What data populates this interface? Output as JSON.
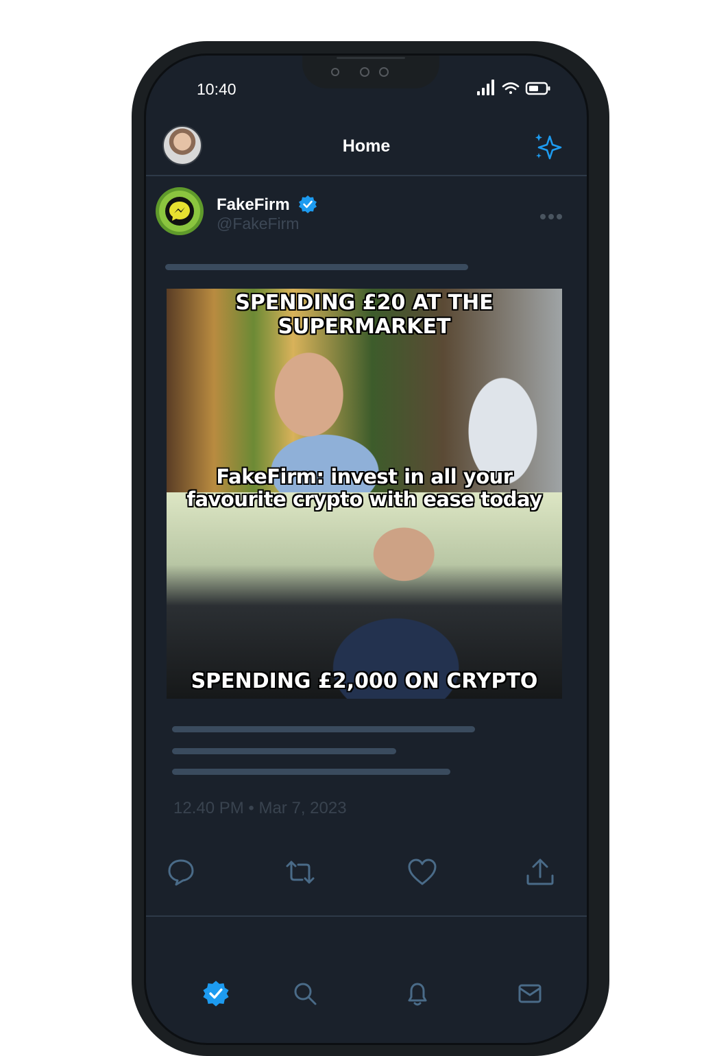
{
  "status_bar": {
    "time": "10:40"
  },
  "header": {
    "title": "Home"
  },
  "tweet": {
    "author_name": "FakeFirm",
    "author_handle": "@FakeFirm",
    "meme": {
      "top_caption": "SPENDING £20 AT THE SUPERMARKET",
      "middle_caption": "FakeFirm: invest in all your favourite crypto with ease today",
      "bottom_caption": "SPENDING £2,000 ON CRYPTO"
    },
    "timestamp": "12.40 PM • Mar 7, 2023"
  },
  "icons": {
    "sparkle": "sparkle-icon",
    "reply": "reply-icon",
    "retweet": "retweet-icon",
    "like": "heart-icon",
    "share": "share-icon",
    "nav_home": "verified-home-icon",
    "nav_search": "search-icon",
    "nav_notifications": "bell-icon",
    "nav_messages": "mail-icon"
  },
  "colors": {
    "background": "#1a212b",
    "accent": "#1d9bf0",
    "icon_muted": "#4a6b88",
    "skeleton": "#3a4b5e"
  }
}
